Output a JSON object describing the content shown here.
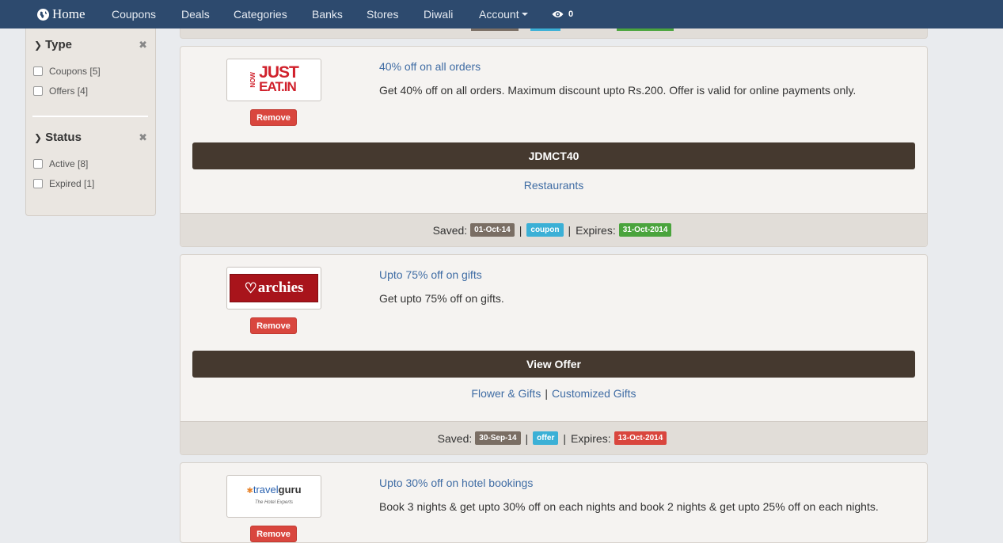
{
  "nav": {
    "brand": "Home",
    "items": [
      "Coupons",
      "Deals",
      "Categories",
      "Banks",
      "Stores",
      "Diwali",
      "Account"
    ],
    "eye_count": "0"
  },
  "sidebar": {
    "type": {
      "heading": "Type",
      "options": [
        "Coupons [5]",
        "Offers [4]"
      ]
    },
    "status": {
      "heading": "Status",
      "options": [
        "Active [8]",
        "Expired [1]"
      ]
    }
  },
  "cards": [
    {
      "logo": {
        "line1": "JUST",
        "line2": "EAT.IN",
        "side": "NOW"
      },
      "remove_label": "Remove",
      "title": "40% off on all orders",
      "description": "Get 40% off on all orders. Maximum discount upto Rs.200. Offer is valid for online payments only.",
      "action": "JDMCT40",
      "categories": [
        "Restaurants"
      ],
      "saved_label": "Saved:",
      "saved_date": "01-Oct-14",
      "kind": "coupon",
      "expires_label": "Expires:",
      "expires_date": "31-Oct-2014",
      "expires_color": "#4aa43d"
    },
    {
      "logo": {
        "text": "archies"
      },
      "remove_label": "Remove",
      "title": "Upto 75% off on gifts",
      "description": "Get upto 75% off on gifts.",
      "action": "View Offer",
      "categories": [
        "Flower & Gifts",
        "Customized Gifts"
      ],
      "saved_label": "Saved:",
      "saved_date": "30-Sep-14",
      "kind": "offer",
      "expires_label": "Expires:",
      "expires_date": "13-Oct-2014",
      "expires_color": "#d9463e"
    },
    {
      "logo": {
        "text1": "travel",
        "text2": "guru",
        "tagline": "The Hotel Experts"
      },
      "remove_label": "Remove",
      "title": "Upto 30% off on hotel bookings",
      "description": "Book 3 nights & get upto 30% off on each nights and book 2 nights & get upto 25% off on each nights."
    }
  ]
}
